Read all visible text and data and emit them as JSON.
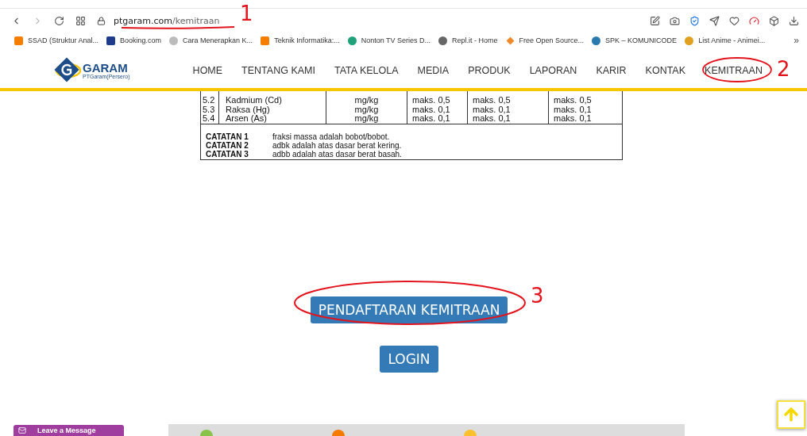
{
  "browser": {
    "url_host": "ptgaram.com",
    "url_path": "/kemitraan",
    "bookmarks": [
      {
        "label": "SSAD (Struktur Anal...",
        "kind": "blogger"
      },
      {
        "label": "Booking.com",
        "kind": "booking"
      },
      {
        "label": "Cara Menerapkan K...",
        "kind": "person"
      },
      {
        "label": "Teknik Informatika:...",
        "kind": "blogger"
      },
      {
        "label": "Nonton TV Series D...",
        "kind": "play"
      },
      {
        "label": "Repl.it - Home",
        "kind": "repl"
      },
      {
        "label": "Free Open Source...",
        "kind": "diamond"
      },
      {
        "label": "SPK – KOMUNICODE",
        "kind": "wordpress"
      },
      {
        "label": "List Anime - Animei...",
        "kind": "anime"
      }
    ],
    "more": "»"
  },
  "site": {
    "logo_title": "GARAM",
    "logo_subtitle": "PTGaram(Persero)",
    "nav": [
      "HOME",
      "TENTANG KAMI",
      "TATA KELOLA",
      "MEDIA",
      "PRODUK",
      "LAPORAN",
      "KARIR",
      "KONTAK",
      "KEMITRAAN"
    ]
  },
  "table": {
    "rows": [
      [
        "5.2",
        "Kadmium (Cd)",
        "mg/kg",
        "maks. 0,5",
        "maks. 0,5",
        "maks. 0,5"
      ],
      [
        "5.3",
        "Raksa (Hg)",
        "mg/kg",
        "maks. 0,1",
        "maks. 0,1",
        "maks. 0,1"
      ],
      [
        "5.4",
        "Arsen (As)",
        "mg/kg",
        "maks. 0,1",
        "maks. 0,1",
        "maks. 0,1"
      ]
    ],
    "notes": [
      {
        "label": "CATATAN 1",
        "text": "fraksi massa adalah bobot/bobot."
      },
      {
        "label": "CATATAN 2",
        "text": "adbk adalah atas dasar berat kering."
      },
      {
        "label": "CATATAN 3",
        "text": "adbb adalah atas dasar berat basah."
      }
    ]
  },
  "buttons": [
    "PENDAFTARAN KEMITRAAN",
    "LOGIN"
  ],
  "leave_message": "Leave a Message",
  "footer_dots": [
    {
      "color": "#8bc34a"
    },
    {
      "color": "#f57c00"
    },
    {
      "color": "#fbc02d"
    }
  ],
  "annotations": [
    "1",
    "2",
    "3"
  ]
}
